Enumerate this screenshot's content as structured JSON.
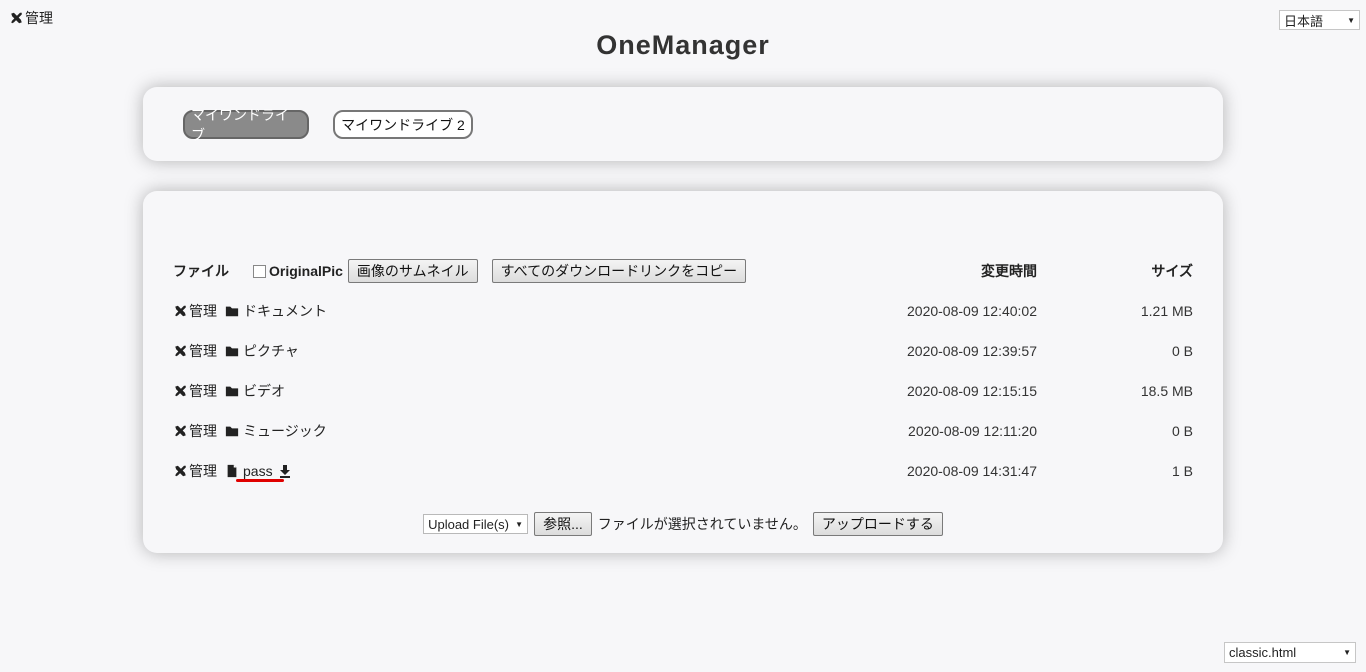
{
  "top": {
    "admin_label": "管理",
    "language": "日本語"
  },
  "site_title": "OneManager",
  "drives": [
    {
      "label": "マイワンドライブ",
      "active": true
    },
    {
      "label": "マイワンドライブ 2",
      "active": false
    }
  ],
  "table": {
    "header_file": "ファイル",
    "original_pic": "OriginalPic",
    "thumbnail_button": "画像のサムネイル",
    "copy_links_button": "すべてのダウンロードリンクをコピー",
    "header_time": "変更時間",
    "header_size": "サイズ",
    "rows": [
      {
        "admin": "管理",
        "type": "folder",
        "name": "ドキュメント",
        "time": "2020-08-09 12:40:02",
        "size": "1.21 MB"
      },
      {
        "admin": "管理",
        "type": "folder",
        "name": "ピクチャ",
        "time": "2020-08-09 12:39:57",
        "size": "0 B"
      },
      {
        "admin": "管理",
        "type": "folder",
        "name": "ビデオ",
        "time": "2020-08-09 12:15:15",
        "size": "18.5 MB"
      },
      {
        "admin": "管理",
        "type": "folder",
        "name": "ミュージック",
        "time": "2020-08-09 12:11:20",
        "size": "0 B"
      },
      {
        "admin": "管理",
        "type": "file",
        "name": "pass",
        "time": "2020-08-09 14:31:47",
        "size": "1 B"
      }
    ]
  },
  "upload": {
    "mode": "Upload File(s)",
    "browse": "参照...",
    "no_file": "ファイルが選択されていません。",
    "submit": "アップロードする"
  },
  "template": "classic.html",
  "colors": {
    "background": "#f7f7f9",
    "active_drive": "#8a8a8a",
    "highlight_underline": "#e00000"
  }
}
